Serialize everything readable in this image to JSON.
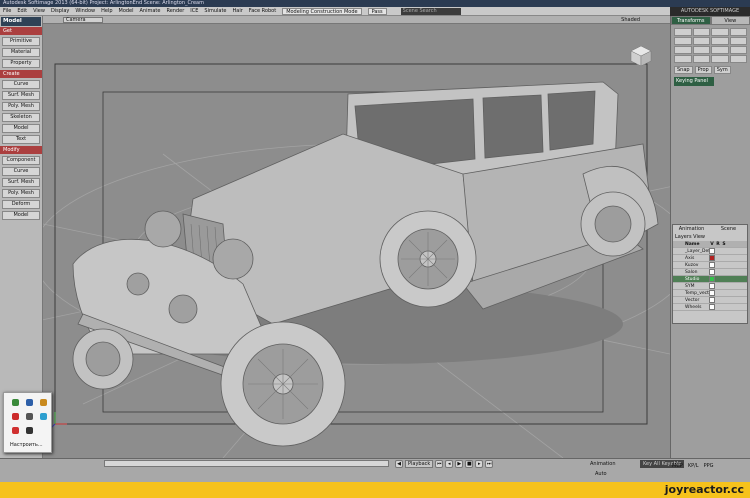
{
  "window": {
    "title": "Autodesk Softimage 2013 (64-bit)    Project: ArlingtonEnd    Scene: Arlington_Cream"
  },
  "menubar": {
    "items": [
      "File",
      "Edit",
      "View",
      "Display",
      "Window",
      "Help",
      "Model",
      "Animate",
      "Render",
      "ICE",
      "Simulate",
      "Hair",
      "Face Robot"
    ],
    "mode": "Modeling Construction Mode",
    "tool": "Pass",
    "search_placeholder": "Scene Search"
  },
  "brand": "AUTODESK SOFTIMAGE",
  "left_panel": {
    "mode": "Model",
    "sections": [
      {
        "title": "Get",
        "buttons": [
          "Primitive",
          "Material",
          "Property"
        ]
      },
      {
        "title": "Create",
        "buttons": [
          "Curve",
          "Surf. Mesh",
          "Poly. Mesh",
          "Skeleton",
          "Model",
          "Text"
        ]
      },
      {
        "title": "Modify",
        "buttons": [
          "Component",
          "Curve",
          "Surf. Mesh",
          "Poly. Mesh",
          "Deform",
          "Model"
        ]
      }
    ]
  },
  "viewport": {
    "camera": "Camera",
    "shading": "Shaded"
  },
  "right_panel": {
    "tabs": [
      "Transforms",
      "View"
    ],
    "tool_buttons": [
      "Snap",
      "Prop",
      "Sym"
    ],
    "keying_panel": "Keying Panel"
  },
  "layers": {
    "tabs": [
      "Animation",
      "Scene"
    ],
    "toolbar": [
      "Layers",
      "View"
    ],
    "columns": [
      "Name",
      "V",
      "R",
      "S"
    ],
    "rows": [
      {
        "name": "_Layer_Default",
        "color": "#ffffff"
      },
      {
        "name": "Axis",
        "color": "#b22222"
      },
      {
        "name": "Kuzov",
        "color": "#ffffff"
      },
      {
        "name": "Salon",
        "color": "#ffffff"
      },
      {
        "name": "Studio",
        "color": "#33c24a",
        "selected": true
      },
      {
        "name": "SYM",
        "color": "#ffffff"
      },
      {
        "name": "Temp_vector",
        "color": "#ffffff"
      },
      {
        "name": "Vector",
        "color": "#ffffff"
      },
      {
        "name": "Wheels",
        "color": "#ffffff"
      }
    ]
  },
  "timeline": {
    "playback": "Playback",
    "animation": "Animation",
    "auto": "Auto",
    "key_all": "Key All Keyable",
    "mcp_buttons": [
      "MCP",
      "KP/L",
      "PPG"
    ]
  },
  "popup": {
    "label": "Настроить..."
  },
  "watermark": "joyreactor.cc"
}
